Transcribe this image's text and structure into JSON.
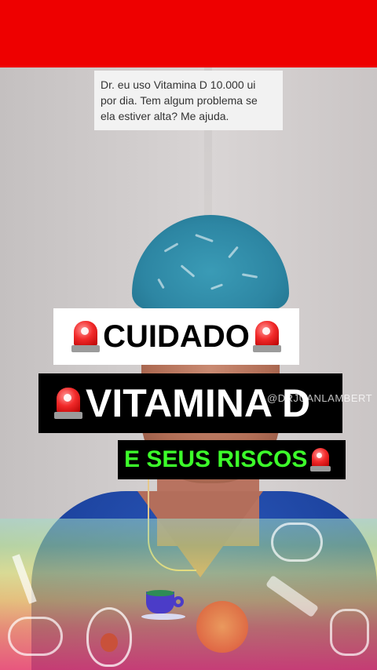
{
  "question": {
    "line1": "Dr. eu uso Vitamina D 10.000 ui",
    "line2": "por dia. Tem algum problema se",
    "line3": "ela estiver alta? Me ajuda."
  },
  "banners": {
    "cuidado": "CUIDADO",
    "vitamina": "VITAMINA D",
    "riscos": "E SEUS RISCOS"
  },
  "watermark": "@DRJUANLAMBERT",
  "icons": {
    "siren": "police-siren-icon",
    "cup": "tea-cup-icon",
    "brain": "brain-icon",
    "avocado": "avocado-icon",
    "syringe": "syringe-icon",
    "dumbbell": "dumbbell-icon"
  },
  "colors": {
    "top_bar": "#ee0000",
    "cuidado_bg": "#ffffff",
    "vitamina_bg": "#000000",
    "riscos_text": "#3cff2a"
  }
}
